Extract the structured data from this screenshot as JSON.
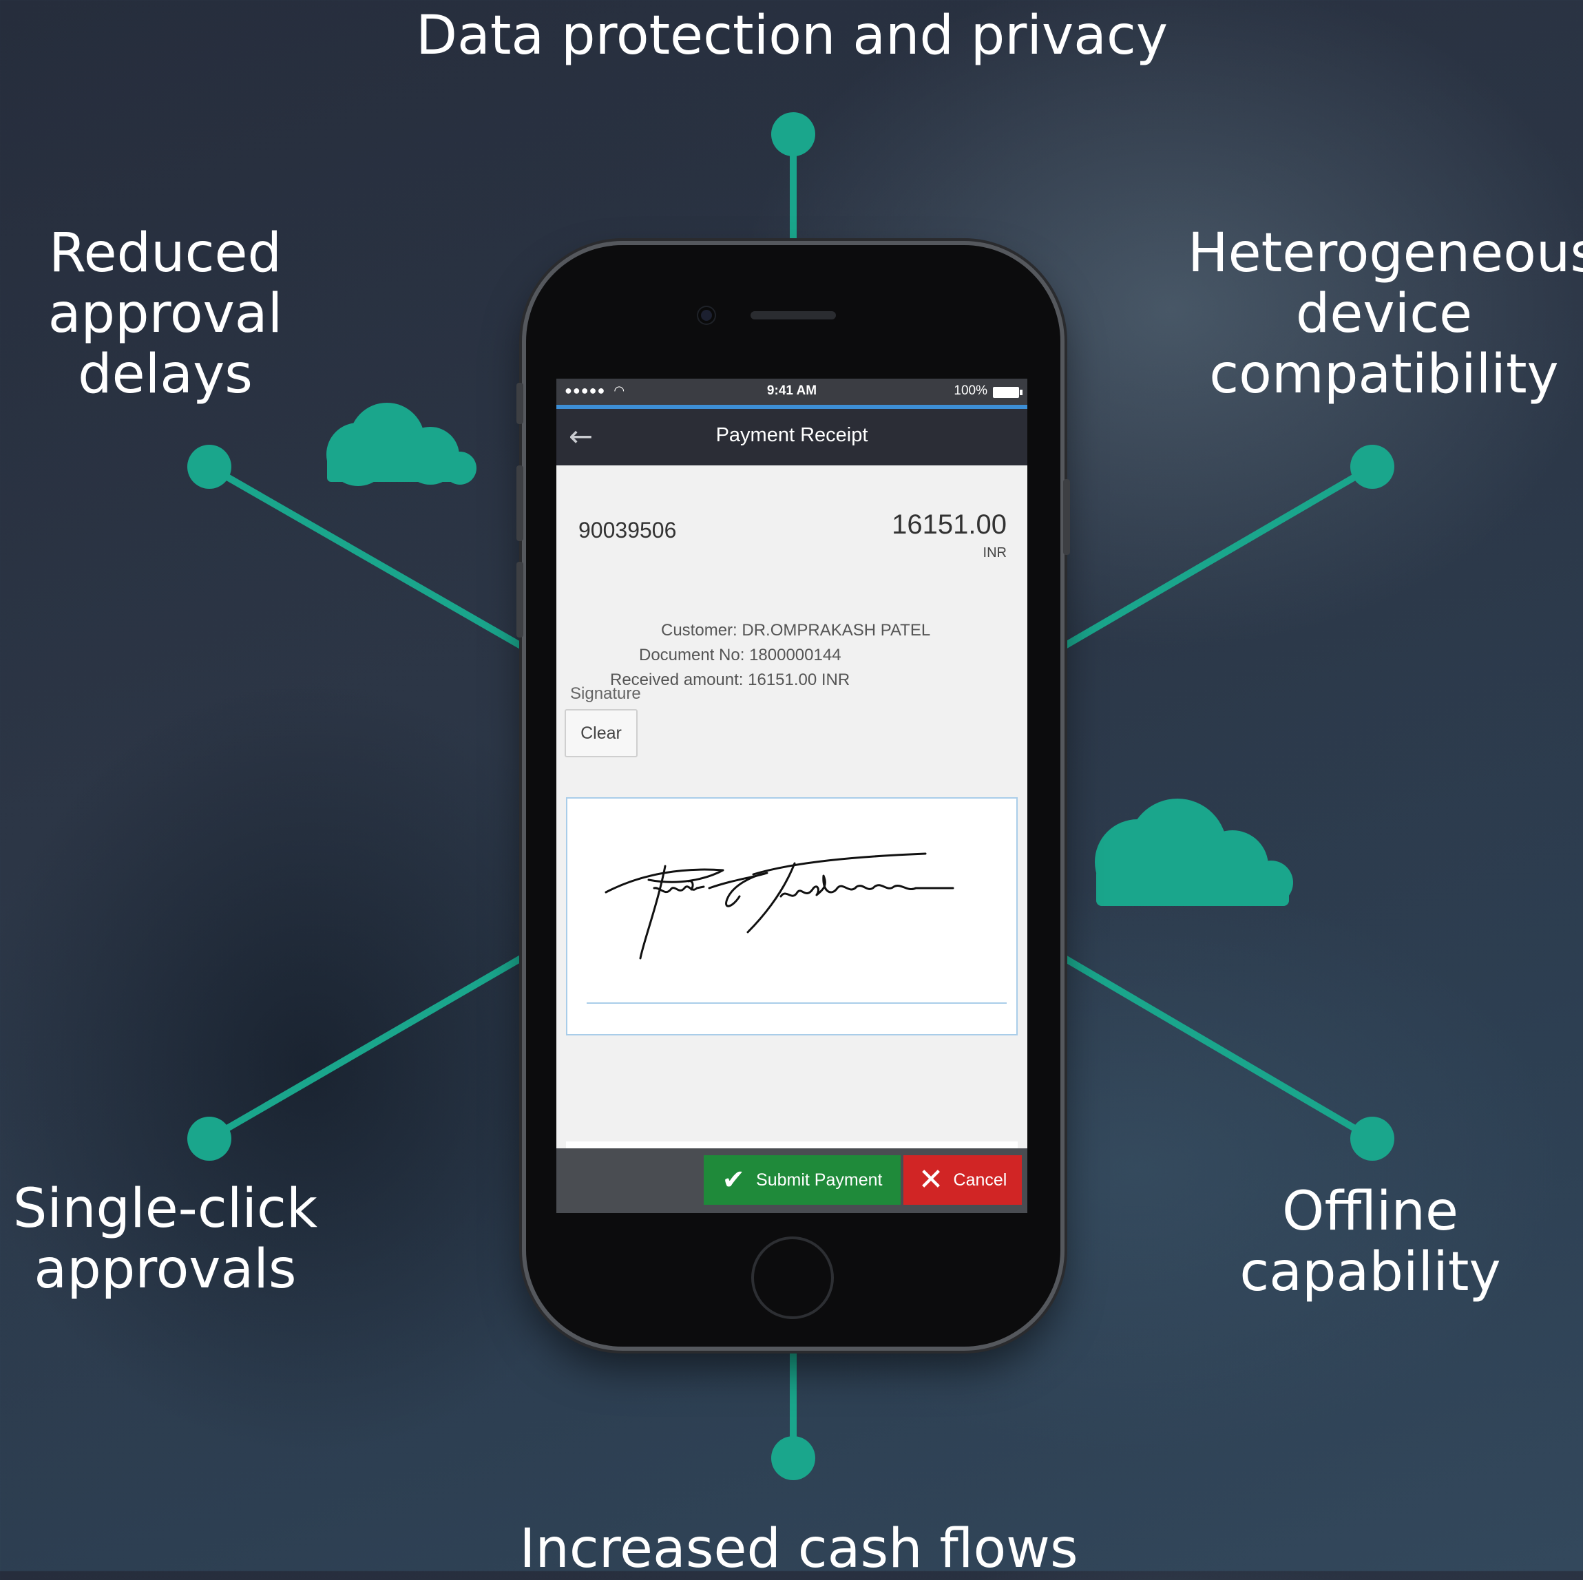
{
  "colors": {
    "accent": "#1aa68c",
    "submit": "#1f8a3a",
    "cancel": "#d12525",
    "status_underline": "#3d8fd6"
  },
  "features": {
    "top": "Data protection and privacy",
    "top_left": "Reduced\napproval\ndelays",
    "top_right": "Heterogeneous\ndevice\ncompatibility",
    "bottom_left": "Single-click\napprovals",
    "bottom_right": "Offline\ncapability",
    "bottom": "Increased cash flows"
  },
  "icons": [
    "cloud-icon",
    "back-arrow-icon",
    "wifi-icon",
    "battery-icon",
    "checkmark-icon",
    "close-icon"
  ],
  "phone": {
    "status_bar": {
      "signal": "●●●●●",
      "time": "9:41 AM",
      "battery": "100%"
    },
    "nav": {
      "back": "←",
      "title": "Payment Receipt"
    },
    "receipt": {
      "document_id": "90039506",
      "amount": "16151.00",
      "currency": "INR",
      "customer": "Customer: DR.OMPRAKASH PATEL",
      "document_no": "Document No: 1800000144",
      "received": "Received amount: 16151.00 INR"
    },
    "signature_label": "Signature",
    "clear_label": "Clear",
    "submit_label": "Submit Payment",
    "cancel_label": "Cancel",
    "check_glyph": "✔",
    "close_glyph": "✕"
  }
}
